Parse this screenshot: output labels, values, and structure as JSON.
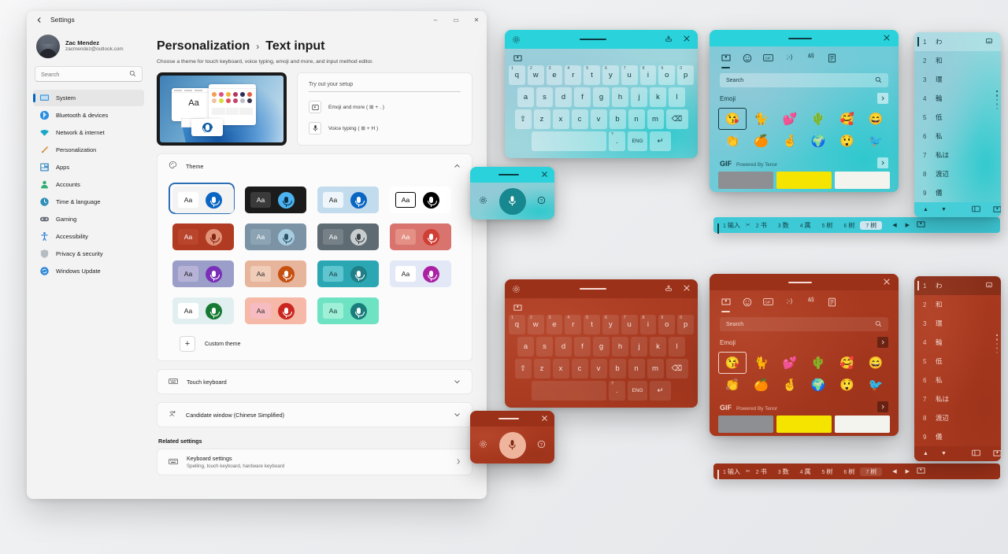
{
  "settings": {
    "titlebar": {
      "back_icon": "back-arrow-icon",
      "title": "Settings",
      "minimize": "–",
      "maximize": "▭",
      "close": "✕"
    },
    "profile": {
      "name": "Zac Mendez",
      "email": "zacmendez@outlook.com"
    },
    "search": {
      "placeholder": "Search",
      "icon": "search-icon"
    },
    "nav_items": [
      {
        "label": "System",
        "icon": "monitor-icon",
        "active": true
      },
      {
        "label": "Bluetooth & devices",
        "icon": "bluetooth-icon",
        "active": false
      },
      {
        "label": "Network & internet",
        "icon": "wifi-icon",
        "active": false
      },
      {
        "label": "Personalization",
        "icon": "brush-icon",
        "active": false
      },
      {
        "label": "Apps",
        "icon": "apps-icon",
        "active": false
      },
      {
        "label": "Accounts",
        "icon": "person-icon",
        "active": false
      },
      {
        "label": "Time & language",
        "icon": "clock-globe-icon",
        "active": false
      },
      {
        "label": "Gaming",
        "icon": "gamepad-icon",
        "active": false
      },
      {
        "label": "Accessibility",
        "icon": "accessibility-icon",
        "active": false
      },
      {
        "label": "Privacy & security",
        "icon": "shield-icon",
        "active": false
      },
      {
        "label": "Windows Update",
        "icon": "update-icon",
        "active": false
      }
    ],
    "breadcrumb": {
      "parent": "Personalization",
      "separator": "›",
      "current": "Text input"
    },
    "subtitle": "Choose a theme for touch keyboard, voice typing, emoji and more, and input method editor.",
    "try_card": {
      "input_placeholder": "Try out your setup",
      "rows": [
        {
          "label": "Emoji and more ( ⊞ + . )",
          "icon": "emoji-panel-icon"
        },
        {
          "label": "Voice typing ( ⊞ + H )",
          "icon": "microphone-icon"
        }
      ]
    },
    "theme_section": {
      "label": "Theme",
      "icon": "theme-icon",
      "chevron": "⌃"
    },
    "themes": [
      {
        "id": "default-light",
        "selected": true,
        "bg": "#f3f3f3",
        "chip": "#ffffff",
        "aa_color": "#1b1b1b",
        "mic": "#0a66c2",
        "mic_glyph": "#ffffff"
      },
      {
        "id": "dark",
        "selected": false,
        "bg": "#1b1b1b",
        "chip": "#3a3a3a",
        "aa_color": "#ffffff",
        "mic": "#4cb3f0",
        "mic_glyph": "#08314d"
      },
      {
        "id": "light-blue",
        "selected": false,
        "bg": "#c3dced",
        "chip": "#eef6fb",
        "aa_color": "#1b1b1b",
        "mic": "#0a66c2",
        "mic_glyph": "#ffffff"
      },
      {
        "id": "high-contrast",
        "selected": false,
        "bg": "#ffffff",
        "chip": "#ffffff",
        "aa_color": "#000000",
        "mic": "#000000",
        "mic_glyph": "#ffffff"
      },
      {
        "id": "brick-red",
        "selected": false,
        "bg": "#b03a22",
        "chip": "#b9452d",
        "aa_color": "#ffffff",
        "mic": "#e29279",
        "mic_glyph": "#7e2512"
      },
      {
        "id": "slate-blue",
        "selected": false,
        "bg": "#7b93a5",
        "chip": "#8ba3b3",
        "aa_color": "#ffffff",
        "mic": "#a8cde0",
        "mic_glyph": "#2d5266"
      },
      {
        "id": "gray",
        "selected": false,
        "bg": "#5e6b72",
        "chip": "#768087",
        "aa_color": "#ffffff",
        "mic": "#c9cdcf",
        "mic_glyph": "#3a4247"
      },
      {
        "id": "sunset",
        "selected": false,
        "bg": "#d9736e",
        "chip": "#e49084",
        "aa_color": "#ffffff",
        "mic": "#cf3f33",
        "mic_glyph": "#ffffff"
      },
      {
        "id": "lilac-wave",
        "selected": false,
        "bg": "#9a9ec8",
        "chip": "#b7b3d6",
        "aa_color": "#1b1b1b",
        "mic": "#7a2fb8",
        "mic_glyph": "#ffffff"
      },
      {
        "id": "peach-sand",
        "selected": false,
        "bg": "#e7b49c",
        "chip": "#f0cdb9",
        "aa_color": "#2a2a2a",
        "mic": "#c5500f",
        "mic_glyph": "#ffffff"
      },
      {
        "id": "teal-crystal",
        "selected": false,
        "bg": "#2ba7b4",
        "chip": "#5fc6cf",
        "aa_color": "#14383d",
        "mic": "#1f7f86",
        "mic_glyph": "#ffffff"
      },
      {
        "id": "pale-violet",
        "selected": false,
        "bg": "#e3e8f7",
        "chip": "#ffffff",
        "aa_color": "#1b1b1b",
        "mic": "#ab21a3",
        "mic_glyph": "#ffffff"
      },
      {
        "id": "mint-white",
        "selected": false,
        "bg": "#e1eff0",
        "chip": "#ffffff",
        "aa_color": "#1b1b1b",
        "mic": "#177a32",
        "mic_glyph": "#ffffff"
      },
      {
        "id": "rose-coral",
        "selected": false,
        "bg": "#f6b8a7",
        "chip": "#f6bcc2",
        "aa_color": "#2a2a2a",
        "mic": "#cb261f",
        "mic_glyph": "#ffffff"
      },
      {
        "id": "aqua-mint",
        "selected": false,
        "bg": "#6ee3c3",
        "chip": "#9ff0d6",
        "aa_color": "#143a33",
        "mic": "#1a7d7c",
        "mic_glyph": "#ffffff"
      }
    ],
    "custom_theme": {
      "label": "Custom theme",
      "plus": "+"
    },
    "touch_keyboard": {
      "label": "Touch keyboard",
      "icon": "keyboard-icon",
      "chevron": "⌄"
    },
    "candidate_window": {
      "label": "Candidate window (Chinese Simplified)",
      "icon": "ime-icon",
      "chevron": "⌄"
    },
    "related": {
      "title": "Related settings",
      "item": {
        "title": "Keyboard settings",
        "subtitle": "Spelling, touch keyboard, hardware keyboard",
        "icon": "keyboard-icon",
        "chevron": "›"
      }
    }
  },
  "keyboard": {
    "toolbar": {
      "settings_icon": "gear-icon",
      "dock_icon": "dock-icon",
      "close_icon": "close-icon"
    },
    "emoji_button": "emoji-heart-icon",
    "row1": [
      {
        "key": "q",
        "num": "1"
      },
      {
        "key": "w",
        "num": "2"
      },
      {
        "key": "e",
        "num": "3"
      },
      {
        "key": "r",
        "num": "4"
      },
      {
        "key": "t",
        "num": "5"
      },
      {
        "key": "y",
        "num": "6"
      },
      {
        "key": "u",
        "num": "7"
      },
      {
        "key": "i",
        "num": "8"
      },
      {
        "key": "o",
        "num": "9"
      },
      {
        "key": "p",
        "num": "0"
      }
    ],
    "row2": [
      "a",
      "s",
      "d",
      "f",
      "g",
      "h",
      "j",
      "k",
      "l"
    ],
    "row3": {
      "shift": "⇧",
      "keys": [
        "z",
        "x",
        "c",
        "v",
        "b",
        "n",
        "m"
      ],
      "backspace": "⌫"
    },
    "row4": {
      "space": "",
      "punct_top": "?",
      "punct": ".",
      "lang": "ENG",
      "enter": "↵"
    }
  },
  "voice": {
    "close": "✕",
    "settings_icon": "gear-icon",
    "mic_icon": "microphone-icon",
    "help_icon": "help-icon"
  },
  "emoji_panel": {
    "close": "✕",
    "tabs": [
      {
        "icon": "recent-heart-icon",
        "glyph": "♡",
        "active": true
      },
      {
        "icon": "emoji-smiley-icon",
        "glyph": "☺",
        "active": false
      },
      {
        "icon": "gif-icon",
        "glyph": "GIF",
        "active": false
      },
      {
        "icon": "kaomoji-icon",
        "glyph": ";-)",
        "active": false
      },
      {
        "icon": "symbols-icon",
        "glyph": "&§",
        "active": false
      },
      {
        "icon": "clipboard-icon",
        "glyph": "☰",
        "active": false
      }
    ],
    "search": {
      "placeholder": "Search",
      "icon": "search-icon"
    },
    "emoji_section": {
      "title": "Emoji",
      "more": "›"
    },
    "emojis": [
      "😘",
      "🐈",
      "💕",
      "🌵",
      "🥰",
      "😄",
      "👏",
      "🍊",
      "🤞",
      "🌍",
      "😲",
      "🐦"
    ],
    "gif_section": {
      "title": "GIF",
      "subtitle": "Powered By Tenor",
      "more": "›"
    },
    "gif_colors": [
      "#8d8f92",
      "#f5e300",
      "#f4f4ef"
    ]
  },
  "ime_bar": {
    "candidates": [
      {
        "n": "1",
        "t": "输入",
        "selected": false
      },
      {
        "n": "2",
        "t": "书",
        "selected": false
      },
      {
        "n": "3",
        "t": "数",
        "selected": false
      },
      {
        "n": "4",
        "t": "属",
        "selected": false
      },
      {
        "n": "5",
        "t": "树",
        "selected": false
      },
      {
        "n": "6",
        "t": "树",
        "selected": false
      },
      {
        "n": "7",
        "t": "树",
        "selected": true
      }
    ],
    "prev": "◀",
    "next": "▶",
    "fav_icon": "emoji-heart-icon"
  },
  "jp_panel": {
    "rows": [
      {
        "n": "1",
        "t": "わ",
        "selected": true,
        "right_icon": "keyboard-mini-icon"
      },
      {
        "n": "2",
        "t": "和",
        "selected": false,
        "right_icon": ""
      },
      {
        "n": "3",
        "t": "環",
        "selected": false,
        "right_icon": ""
      },
      {
        "n": "4",
        "t": "輪",
        "selected": false,
        "right_icon": ""
      },
      {
        "n": "5",
        "t": "低",
        "selected": false,
        "right_icon": ""
      },
      {
        "n": "6",
        "t": "私",
        "selected": false,
        "right_icon": ""
      },
      {
        "n": "7",
        "t": "私は",
        "selected": false,
        "right_icon": ""
      },
      {
        "n": "8",
        "t": "渡辺",
        "selected": false,
        "right_icon": ""
      },
      {
        "n": "9",
        "t": "儀",
        "selected": false,
        "right_icon": ""
      }
    ],
    "footer": {
      "up": "▲",
      "down": "▼",
      "expand_icon": "expand-icon",
      "fav_icon": "emoji-heart-icon"
    }
  },
  "themes_applied": {
    "teal": {
      "accent": "#2ad3dc",
      "accent_dark": "#1a9aa4",
      "surface": "#8fd8de",
      "key_bg": "rgba(255,255,255,0.34)",
      "text": "#16343a",
      "tb_text": "#0e3a40"
    },
    "red": {
      "accent": "#a8391f",
      "accent_dark": "#8e2e17",
      "surface": "#ad3d23",
      "key_bg": "rgba(255,255,255,0.10)",
      "text": "#f6ded6",
      "tb_text": "#f3d8cf"
    }
  }
}
